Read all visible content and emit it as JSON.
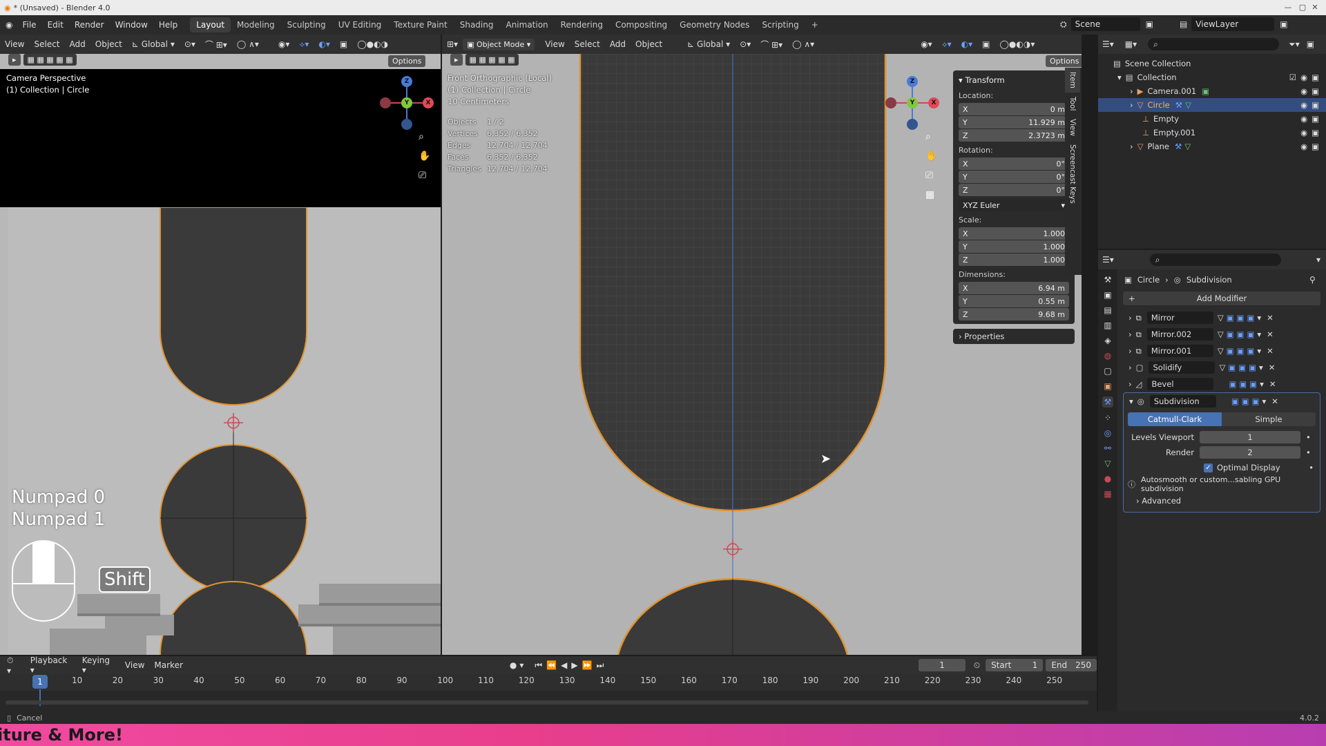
{
  "window": {
    "title": "* (Unsaved) - Blender 4.0"
  },
  "menus": [
    "File",
    "Edit",
    "Render",
    "Window",
    "Help"
  ],
  "workspaces": [
    "Layout",
    "Modeling",
    "Sculpting",
    "UV Editing",
    "Texture Paint",
    "Shading",
    "Animation",
    "Rendering",
    "Compositing",
    "Geometry Nodes",
    "Scripting"
  ],
  "scene": {
    "label": "Scene",
    "viewlayer": "ViewLayer"
  },
  "left_view": {
    "menus": [
      "View",
      "Select",
      "Add",
      "Object"
    ],
    "transform": "Global",
    "options": "Options",
    "overlay_line1": "Camera Perspective",
    "overlay_line2": "(1) Collection | Circle",
    "key1": "Numpad 0",
    "key2": "Numpad 1",
    "shift": "Shift"
  },
  "right_view": {
    "mode": "Object Mode",
    "menus": [
      "View",
      "Select",
      "Add",
      "Object"
    ],
    "transform": "Global",
    "options": "Options",
    "overlay_line1": "Front Orthographic (Local)",
    "overlay_line2": "(1) Collection | Circle",
    "overlay_line3": "10 Centimeters",
    "stats": [
      [
        "Objects",
        "1 / 2"
      ],
      [
        "Vertices",
        "6,352 / 6,352"
      ],
      [
        "Edges",
        "12,704 / 12,704"
      ],
      [
        "Faces",
        "6,352 / 6,352"
      ],
      [
        "Triangles",
        "12,704 / 12,704"
      ]
    ]
  },
  "npanel": {
    "header": "Transform",
    "location_label": "Location:",
    "location": [
      [
        "X",
        "0 m"
      ],
      [
        "Y",
        "11.929 m"
      ],
      [
        "Z",
        "2.3723 m"
      ]
    ],
    "rotation_label": "Rotation:",
    "rotation": [
      [
        "X",
        "0°"
      ],
      [
        "Y",
        "0°"
      ],
      [
        "Z",
        "0°"
      ]
    ],
    "rotation_mode": "XYZ Euler",
    "scale_label": "Scale:",
    "scale": [
      [
        "X",
        "1.000"
      ],
      [
        "Y",
        "1.000"
      ],
      [
        "Z",
        "1.000"
      ]
    ],
    "dimensions_label": "Dimensions:",
    "dimensions": [
      [
        "X",
        "6.94 m"
      ],
      [
        "Y",
        "0.55 m"
      ],
      [
        "Z",
        "9.68 m"
      ]
    ],
    "properties": "Properties",
    "tabs": [
      "Item",
      "Tool",
      "View",
      "Screencast Keys"
    ]
  },
  "outliner": {
    "root": "Scene Collection",
    "collection": "Collection",
    "items": [
      "Camera.001",
      "Circle",
      "Empty",
      "Empty.001",
      "Plane"
    ]
  },
  "properties": {
    "breadcrumb_object": "Circle",
    "breadcrumb_modifier": "Subdivision",
    "add_modifier": "Add Modifier",
    "modifiers": [
      "Mirror",
      "Mirror.002",
      "Mirror.001",
      "Solidify",
      "Bevel",
      "Subdivision"
    ],
    "type_catmull": "Catmull-Clark",
    "type_simple": "Simple",
    "levels_viewport_label": "Levels Viewport",
    "levels_viewport": "1",
    "render_label": "Render",
    "render": "2",
    "optimal_display": "Optimal Display",
    "info": "Autosmooth or custom...sabling GPU subdivision",
    "advanced": "Advanced"
  },
  "timeline": {
    "menus": [
      "Playback",
      "Keying",
      "View",
      "Marker"
    ],
    "current": "1",
    "start_label": "Start",
    "start": "1",
    "end_label": "End",
    "end": "250",
    "ticks": [
      "10",
      "20",
      "30",
      "40",
      "50",
      "60",
      "70",
      "80",
      "90",
      "100",
      "110",
      "120",
      "130",
      "140",
      "150",
      "160",
      "170",
      "180",
      "190",
      "200",
      "210",
      "220",
      "230",
      "240",
      "250"
    ],
    "current_marker": "1"
  },
  "status": {
    "left": "Cancel",
    "version": "4.0.2"
  },
  "banner": {
    "text": "iture & More!"
  }
}
